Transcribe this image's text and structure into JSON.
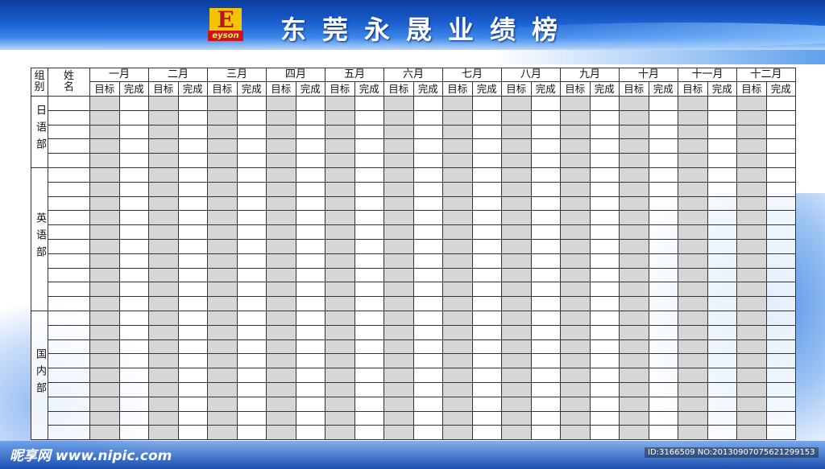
{
  "header": {
    "title": "东莞永晟业绩榜",
    "logo_letter": "E",
    "logo_sub": "eyson"
  },
  "table": {
    "group_header": "组别",
    "name_header": "姓名",
    "months": [
      "一月",
      "二月",
      "三月",
      "四月",
      "五月",
      "六月",
      "七月",
      "八月",
      "九月",
      "十月",
      "十一月",
      "十二月"
    ],
    "sub_headers": [
      "目标",
      "完成"
    ],
    "groups": [
      {
        "label": "日语部",
        "rows": 5
      },
      {
        "label": "英语部",
        "rows": 10
      },
      {
        "label": "国内部",
        "rows": 9
      }
    ]
  },
  "watermark": {
    "left": "昵享网 www.nipic.com",
    "right": "ID:3166509 NO:20130907075621299153"
  },
  "colors": {
    "header_blue": "#1a5fd0",
    "target_shade": "#d6d6d6",
    "grid_line": "#333333"
  }
}
